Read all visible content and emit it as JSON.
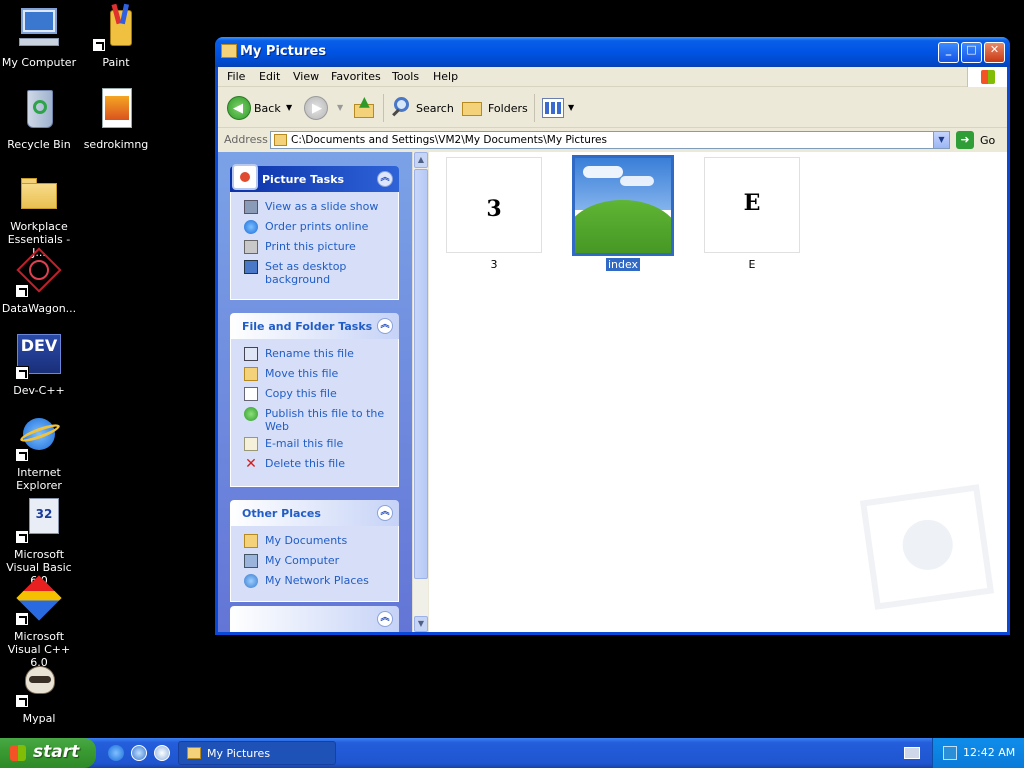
{
  "desktop": {
    "icons": [
      {
        "label": "My Computer"
      },
      {
        "label": "Paint"
      },
      {
        "label": "Recycle Bin"
      },
      {
        "label": "sedrokimng"
      },
      {
        "label": "Workplace Essentials - J..."
      },
      {
        "label": "DataWagon..."
      },
      {
        "label": "Dev-C++"
      },
      {
        "label": "Internet Explorer"
      },
      {
        "label": "Microsoft Visual Basic 6.0"
      },
      {
        "label": "Microsoft Visual C++ 6.0"
      },
      {
        "label": "Mypal"
      }
    ]
  },
  "window": {
    "title": "My Pictures",
    "controls": {
      "minimize": "_",
      "maximize": "□",
      "close": "✕"
    }
  },
  "menu": [
    "File",
    "Edit",
    "View",
    "Favorites",
    "Tools",
    "Help"
  ],
  "toolbar": {
    "back": "Back",
    "search": "Search",
    "folders": "Folders"
  },
  "address": {
    "label": "Address",
    "path": "C:\\Documents and Settings\\VM2\\My Documents\\My Pictures",
    "go": "Go"
  },
  "tasks": {
    "picture": {
      "title": "Picture Tasks",
      "items": [
        "View as a slide show",
        "Order prints online",
        "Print this picture",
        "Set as desktop background"
      ]
    },
    "file": {
      "title": "File and Folder Tasks",
      "items": [
        "Rename this file",
        "Move this file",
        "Copy this file",
        "Publish this file to the Web",
        "E-mail this file",
        "Delete this file"
      ]
    },
    "places": {
      "title": "Other Places",
      "items": [
        "My Documents",
        "My Computer",
        "My Network Places"
      ]
    }
  },
  "files": [
    {
      "name": "3",
      "glyph": "3",
      "selected": false
    },
    {
      "name": "index",
      "glyph": "",
      "selected": true
    },
    {
      "name": "E",
      "glyph": "E",
      "selected": false
    }
  ],
  "taskbar": {
    "start": "start",
    "task": "My Pictures",
    "clock": "12:42 AM"
  },
  "colors": {
    "xp_blue": "#0054e3",
    "task_pane_link": "#215dc6",
    "selection": "#316ac5",
    "start_green": "#3b9b33"
  }
}
